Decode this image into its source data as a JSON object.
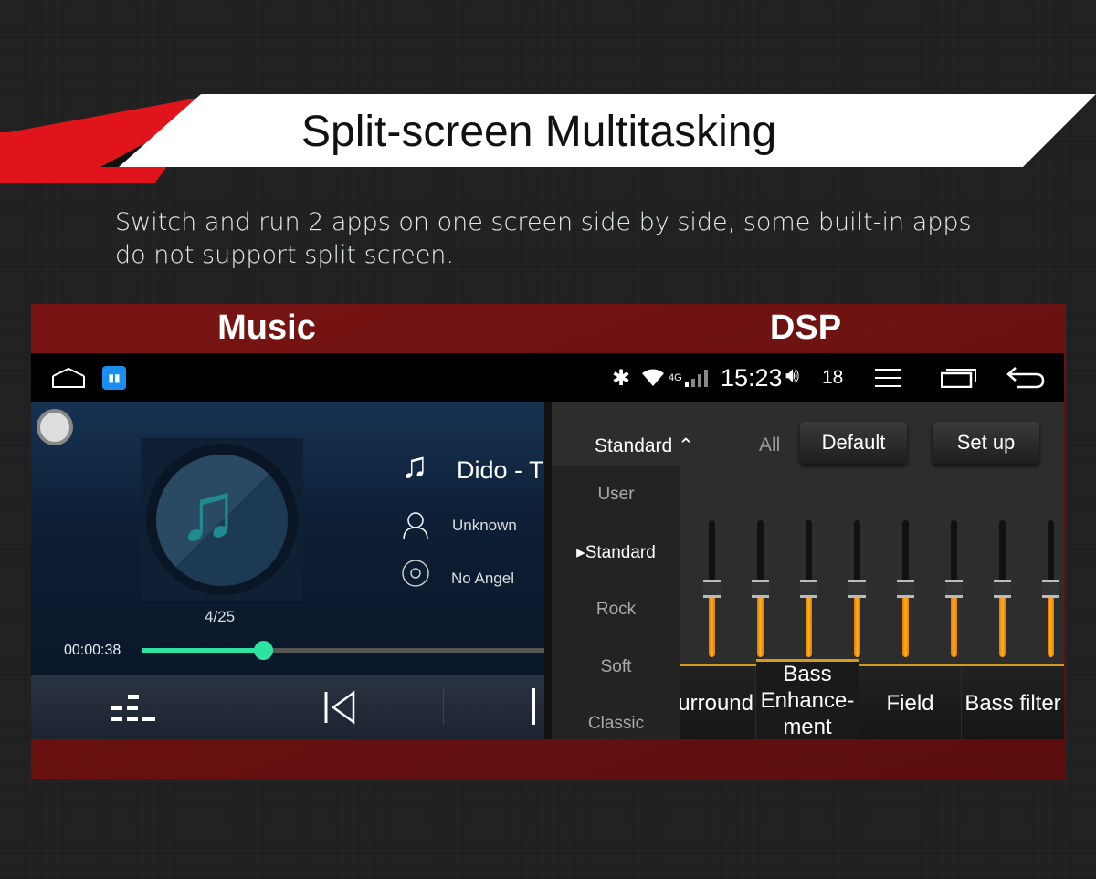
{
  "banner": {
    "title": "Split-screen Multitasking",
    "subtitle": "Switch and run 2 apps on one screen side by side, some built-in apps do not support split screen."
  },
  "labels": {
    "left": "Music",
    "right": "DSP"
  },
  "colors": {
    "accent_red": "#e0141a",
    "panel_red": "#6a1111",
    "progress": "#2ee3a0",
    "slider_fill": "#f39c12"
  },
  "status": {
    "time": "15:23",
    "volume": "18",
    "network": "4G"
  },
  "music": {
    "title": "Dido - T",
    "artist": "Unknown",
    "album": "No Angel",
    "track_index": "4/25",
    "elapsed": "00:00:38",
    "progress": 0.3
  },
  "dsp": {
    "preset": "Standard",
    "all_label": "All",
    "default_label": "Default",
    "setup_label": "Set up",
    "presets": [
      "User",
      "▸Standard",
      "Rock",
      "Soft",
      "Classic"
    ],
    "sliders": [
      0.5,
      0.5,
      0.5,
      0.5,
      0.5,
      0.5,
      0.5,
      0.5
    ],
    "tabs": [
      "Surround",
      "Bass Enhance-ment",
      "Field",
      "Bass filter"
    ],
    "active_tab": 1
  }
}
